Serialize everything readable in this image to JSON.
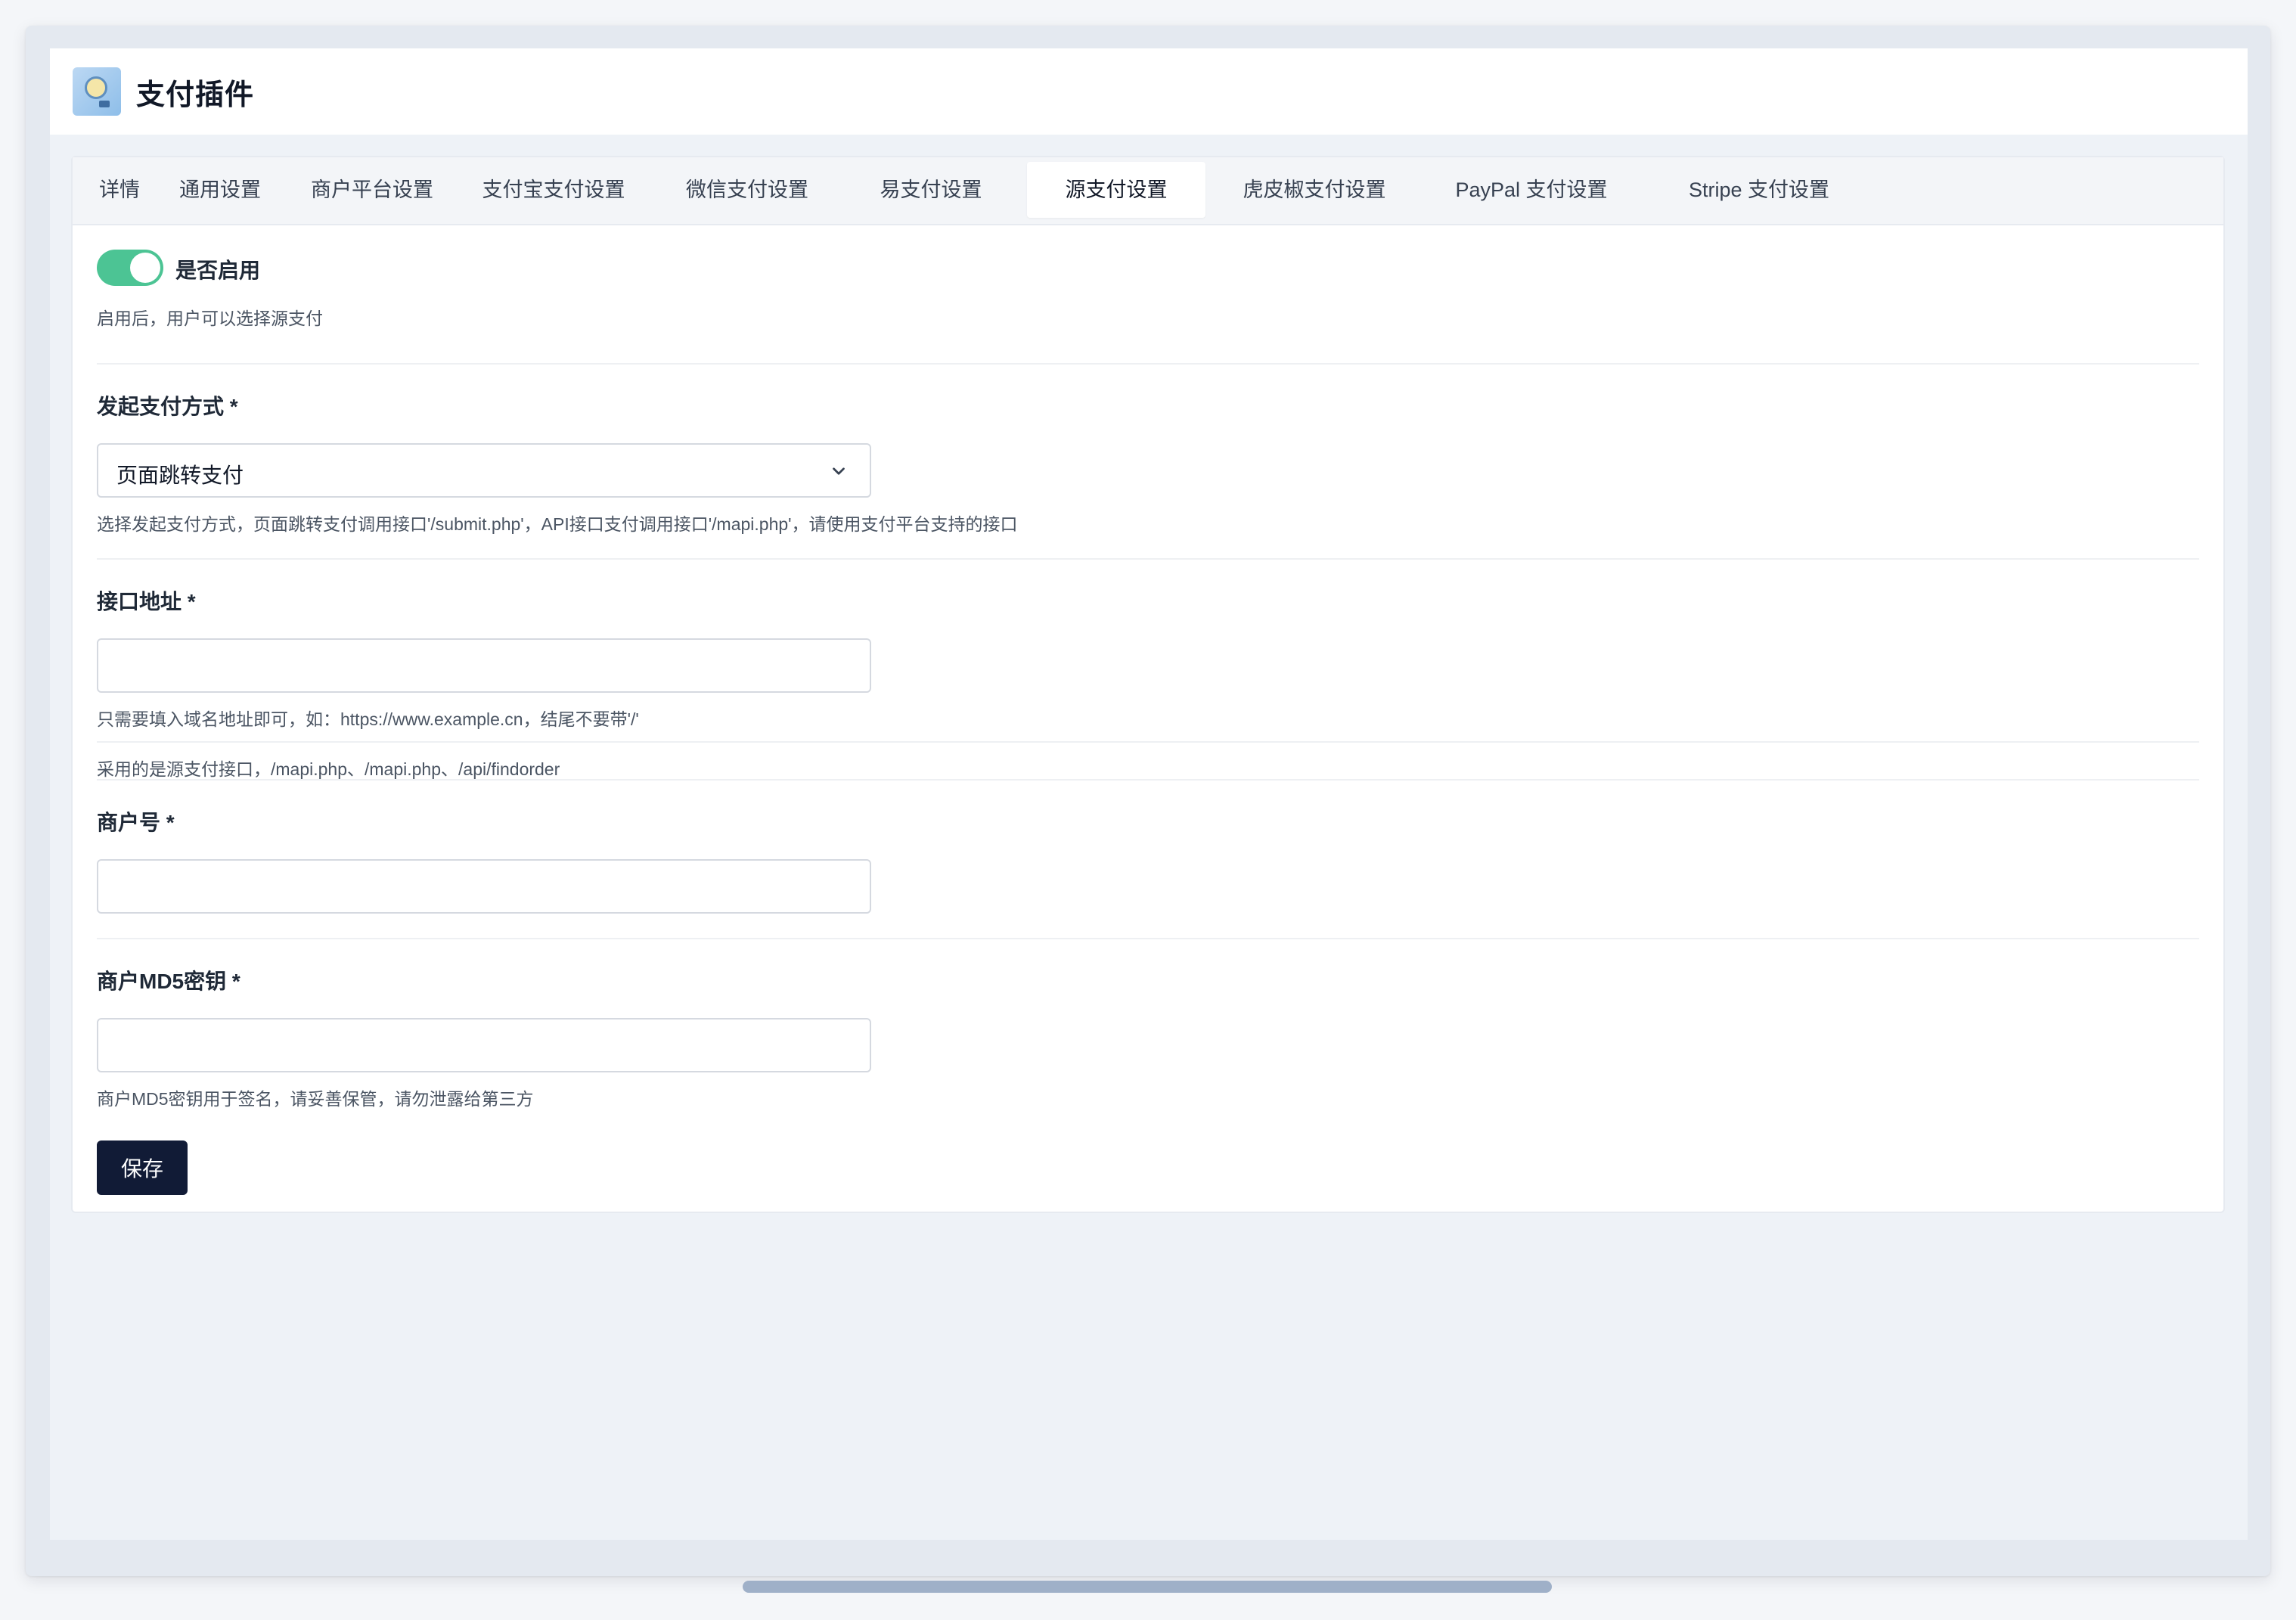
{
  "header": {
    "title": "支付插件",
    "logo_icon": "lightbulb-logo"
  },
  "tabs": [
    {
      "label": "详情"
    },
    {
      "label": "通用设置"
    },
    {
      "label": "商户平台设置"
    },
    {
      "label": "支付宝支付设置"
    },
    {
      "label": "微信支付设置"
    },
    {
      "label": "易支付设置"
    },
    {
      "label": "源支付设置",
      "active": true
    },
    {
      "label": "虎皮椒支付设置"
    },
    {
      "label": "PayPal 支付设置"
    },
    {
      "label": "Stripe 支付设置"
    }
  ],
  "form": {
    "enable": {
      "label": "是否启用",
      "on": true,
      "help": "启用后，用户可以选择源支付"
    },
    "pay_method": {
      "label": "发起支付方式 *",
      "value": "页面跳转支付",
      "help": "选择发起支付方式，页面跳转支付调用接口'/submit.php'，API接口支付调用接口'/mapi.php'，请使用支付平台支持的接口"
    },
    "api_url": {
      "label": "接口地址 *",
      "value": "",
      "help": "只需要填入域名地址即可，如：https://www.example.cn，结尾不要带'/'",
      "note": "采用的是源支付接口，/mapi.php、/mapi.php、/api/findorder"
    },
    "merchant_id": {
      "label": "商户号 *",
      "value": ""
    },
    "md5_key": {
      "label": "商户MD5密钥 *",
      "value": "",
      "help": "商户MD5密钥用于签名，请妥善保管，请勿泄露给第三方"
    },
    "save_label": "保存"
  },
  "colors": {
    "toggle_on": "#4cc494",
    "save_button": "#111b36"
  }
}
